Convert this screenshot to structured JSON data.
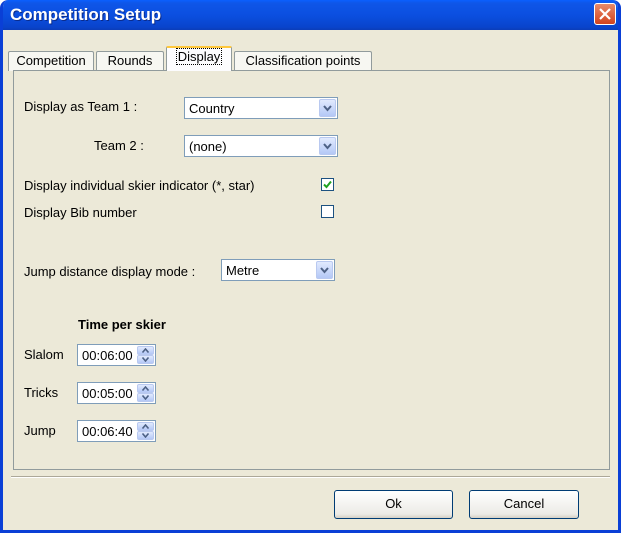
{
  "window": {
    "title": "Competition Setup"
  },
  "tabs": [
    {
      "label": "Competition",
      "active": false
    },
    {
      "label": "Rounds",
      "active": false
    },
    {
      "label": "Display",
      "active": true
    },
    {
      "label": "Classification points",
      "active": false
    }
  ],
  "display": {
    "team1_label": "Display as Team 1 :",
    "team1_value": "Country",
    "team2_label": "Team 2 :",
    "team2_value": "(none)",
    "skier_indicator_label": "Display individual skier indicator (*, star)",
    "skier_indicator_checked": true,
    "bib_label": "Display Bib number",
    "bib_checked": false,
    "jump_mode_label": "Jump distance display mode :",
    "jump_mode_value": "Metre"
  },
  "time_per_skier": {
    "heading": "Time per skier",
    "rows": [
      {
        "label": "Slalom",
        "value": "00:06:00"
      },
      {
        "label": "Tricks",
        "value": "00:05:00"
      },
      {
        "label": "Jump",
        "value": "00:06:40"
      }
    ]
  },
  "buttons": {
    "ok": "Ok",
    "cancel": "Cancel"
  }
}
